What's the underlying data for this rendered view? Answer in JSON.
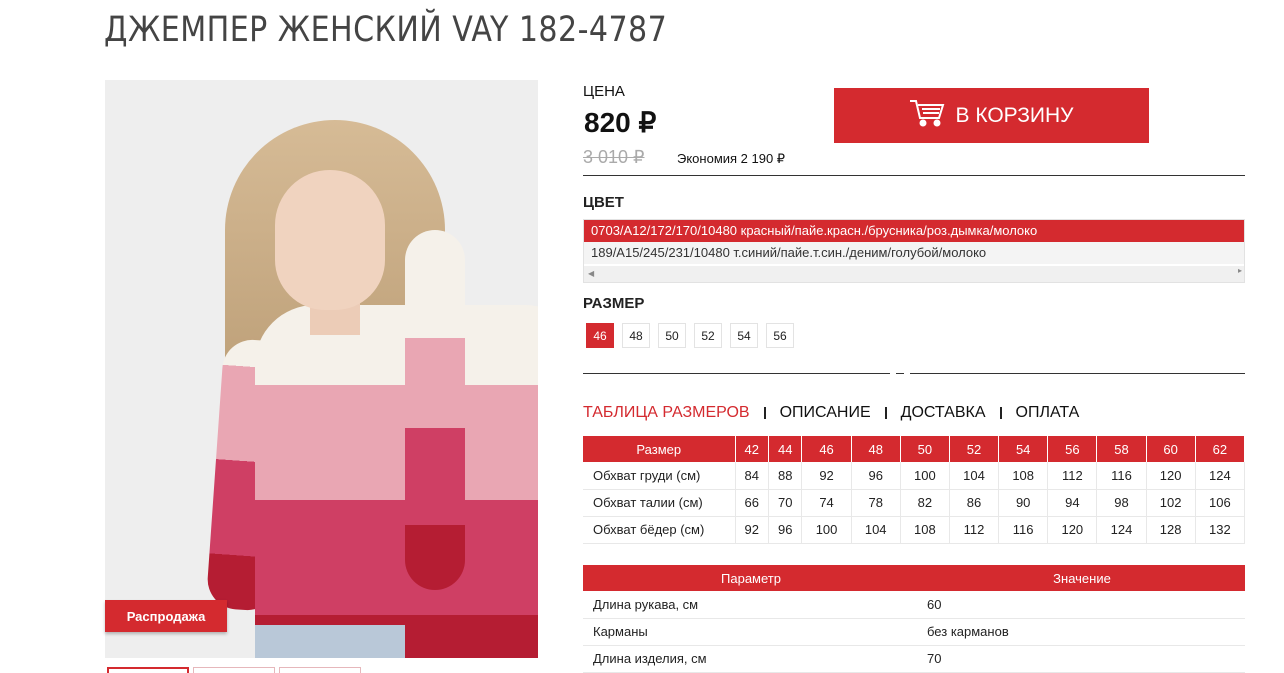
{
  "product": {
    "title": "ДЖЕМПЕР ЖЕНСКИЙ VAY 182-4787",
    "sale_badge": "Распродажа"
  },
  "price": {
    "label": "ЦЕНА",
    "current": "820 ₽",
    "old": "3 010 ₽",
    "economy": "Экономия 2 190 ₽"
  },
  "cart": {
    "button_label": "В КОРЗИНУ"
  },
  "color": {
    "label": "ЦВЕТ",
    "options": [
      "0703/A12/172/170/10480 красный/пайе.красн./брусника/роз.дымка/молоко",
      "189/A15/245/231/10480 т.синий/пайе.т.син./деним/голубой/молоко"
    ]
  },
  "size": {
    "label": "РАЗМЕР",
    "options": [
      "46",
      "48",
      "50",
      "52",
      "54",
      "56"
    ],
    "selected": "46"
  },
  "tabs": [
    "ТАБЛИЦА РАЗМЕРОВ",
    "ОПИСАНИЕ",
    "ДОСТАВКА",
    "ОПЛАТА"
  ],
  "size_table": {
    "header": [
      "Размер",
      "42",
      "44",
      "46",
      "48",
      "50",
      "52",
      "54",
      "56",
      "58",
      "60",
      "62"
    ],
    "rows": [
      [
        "Обхват груди (см)",
        "84",
        "88",
        "92",
        "96",
        "100",
        "104",
        "108",
        "112",
        "116",
        "120",
        "124"
      ],
      [
        "Обхват талии (см)",
        "66",
        "70",
        "74",
        "78",
        "82",
        "86",
        "90",
        "94",
        "98",
        "102",
        "106"
      ],
      [
        "Обхват бёдер (см)",
        "92",
        "96",
        "100",
        "104",
        "108",
        "112",
        "116",
        "120",
        "124",
        "128",
        "132"
      ]
    ]
  },
  "param_table": {
    "header": [
      "Параметр",
      "Значение"
    ],
    "rows": [
      [
        "Длина рукава, см",
        "60"
      ],
      [
        "Карманы",
        "без карманов"
      ],
      [
        "Длина изделия, см",
        "70"
      ]
    ]
  },
  "colors": {
    "accent": "#d42a2f"
  }
}
